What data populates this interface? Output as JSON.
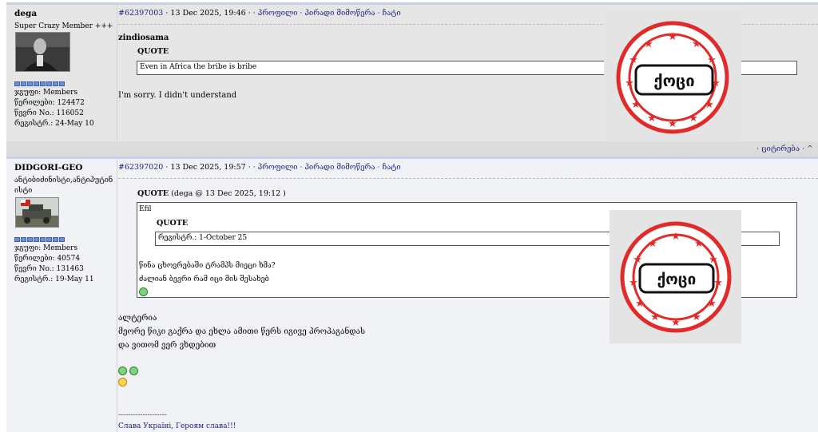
{
  "post1": {
    "username": "dega",
    "rank": "Super Crazy Member +++",
    "group": "ჯგუფი: Members",
    "posts": "წერილები: 124472",
    "member_no": "წევრი No.: 116052",
    "registered": "რეგისტრ.: 24-May 10",
    "post_id": "#62397003",
    "date": "· 13 Dec 2025, 19:46 ·",
    "links": [
      "· პროფილი",
      "· პირადი მიმოწერა",
      "· ჩატი"
    ],
    "quoted_user": "zindiosama",
    "quote_label": "QUOTE",
    "quote_text": "Even in Africa the bribe is bribe",
    "reply_text": "I'm sorry. I didn't understand",
    "stamp_text": "ქოცი"
  },
  "footer": {
    "quote_link": "· ციტირება ·",
    "top_link": "^"
  },
  "post2": {
    "username": "DIDGORI-GEO",
    "rank_line1": "ანტიბიძინისტი,ანტიპუტინ",
    "rank_line2": "ისტი",
    "group": "ჯგუფი: Members",
    "posts": "წერილები: 40574",
    "member_no": "წევრი No.: 131463",
    "registered": "რეგისტრ.: 19-May 11",
    "post_id": "#62397020",
    "date": "· 13 Dec 2025, 19:57 ·",
    "links": [
      "· პროფილი",
      "· პირადი მიმოწერა",
      "· ჩატი"
    ],
    "quote_label": "QUOTE",
    "quote_meta": "(dega @ 13 Dec 2025, 19:12 )",
    "inner_author": "Efil",
    "inner_quote_label": "QUOTE",
    "inner_quote_text": "რეგისტრ.: 1-October 25",
    "quote_line1": "წინა ცხოვრებაში ტრამპს მიეცი ხმა?",
    "quote_line2": "ძალიან ბევრი რამ იცი მის შესახებ",
    "body_line1": "ალტერია",
    "body_line2": "მეორე წიკი გაქრა და ეხლა ამითი წერს იგივე პროპაგანდას",
    "body_line3": "და ვითომ ვერ ვხდებით",
    "signature_sep": "--------------------",
    "signature": "Слава Україні, Героям слава!!!",
    "stamp_text": "ქოცი"
  }
}
